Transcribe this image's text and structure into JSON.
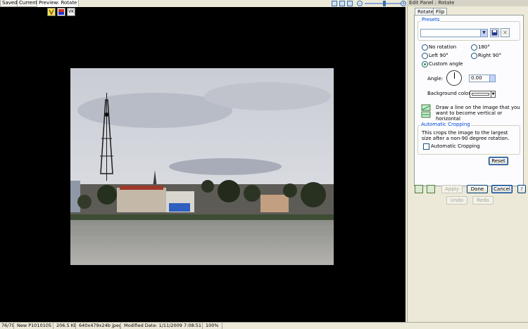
{
  "tabs": [
    {
      "label": "Saved"
    },
    {
      "label": "Current"
    },
    {
      "label": "Preview: Rotate"
    }
  ],
  "panel": {
    "title": "Edit Panel : Rotate",
    "tabs": [
      {
        "label": "Rotate"
      },
      {
        "label": "Flip"
      }
    ],
    "presets": {
      "title": "Presets",
      "value": ""
    },
    "rotation_options": {
      "no_rotation": "No rotation",
      "r180": "180°",
      "left90": "Left 90°",
      "right90": "Right 90°",
      "custom": "Custom angle"
    },
    "angle": {
      "label": "Angle:",
      "value": "0.00"
    },
    "background_color": {
      "label": "Background color:",
      "color": "#ffffff"
    },
    "straighten_hint": "Draw a line on the image that you want to become vertical or horizontal",
    "auto_crop": {
      "title": "Automatic Cropping",
      "description": "This crops the image to the largest size after a non-90 degree rotation.",
      "checkbox_label": "Automatic Cropping",
      "checked": false
    },
    "reset_label": "Reset",
    "apply_label": "Apply",
    "done_label": "Done",
    "cancel_label": "Cancel",
    "undo_label": "Undo",
    "redo_label": "Redo",
    "help_icon": "?"
  },
  "status": {
    "index": "76/79",
    "name": "New  P1010105",
    "size": "206.5 KB",
    "dimensions": "640x479x24b jpeg",
    "modified": "Modified Date: 1/11/2009 7:08:51 PM",
    "zoom": "100%"
  },
  "colors": {
    "accent": "#0046d5",
    "canvas_bg": "#000000",
    "panel_bg": "#ece9d8"
  },
  "icons": [
    "v-icon",
    "flag-icon",
    "vk-icon",
    "zoom-minus-icon",
    "zoom-plus-icon",
    "save-preset-icon",
    "delete-preset-icon",
    "straighten-icon",
    "help-icon"
  ]
}
